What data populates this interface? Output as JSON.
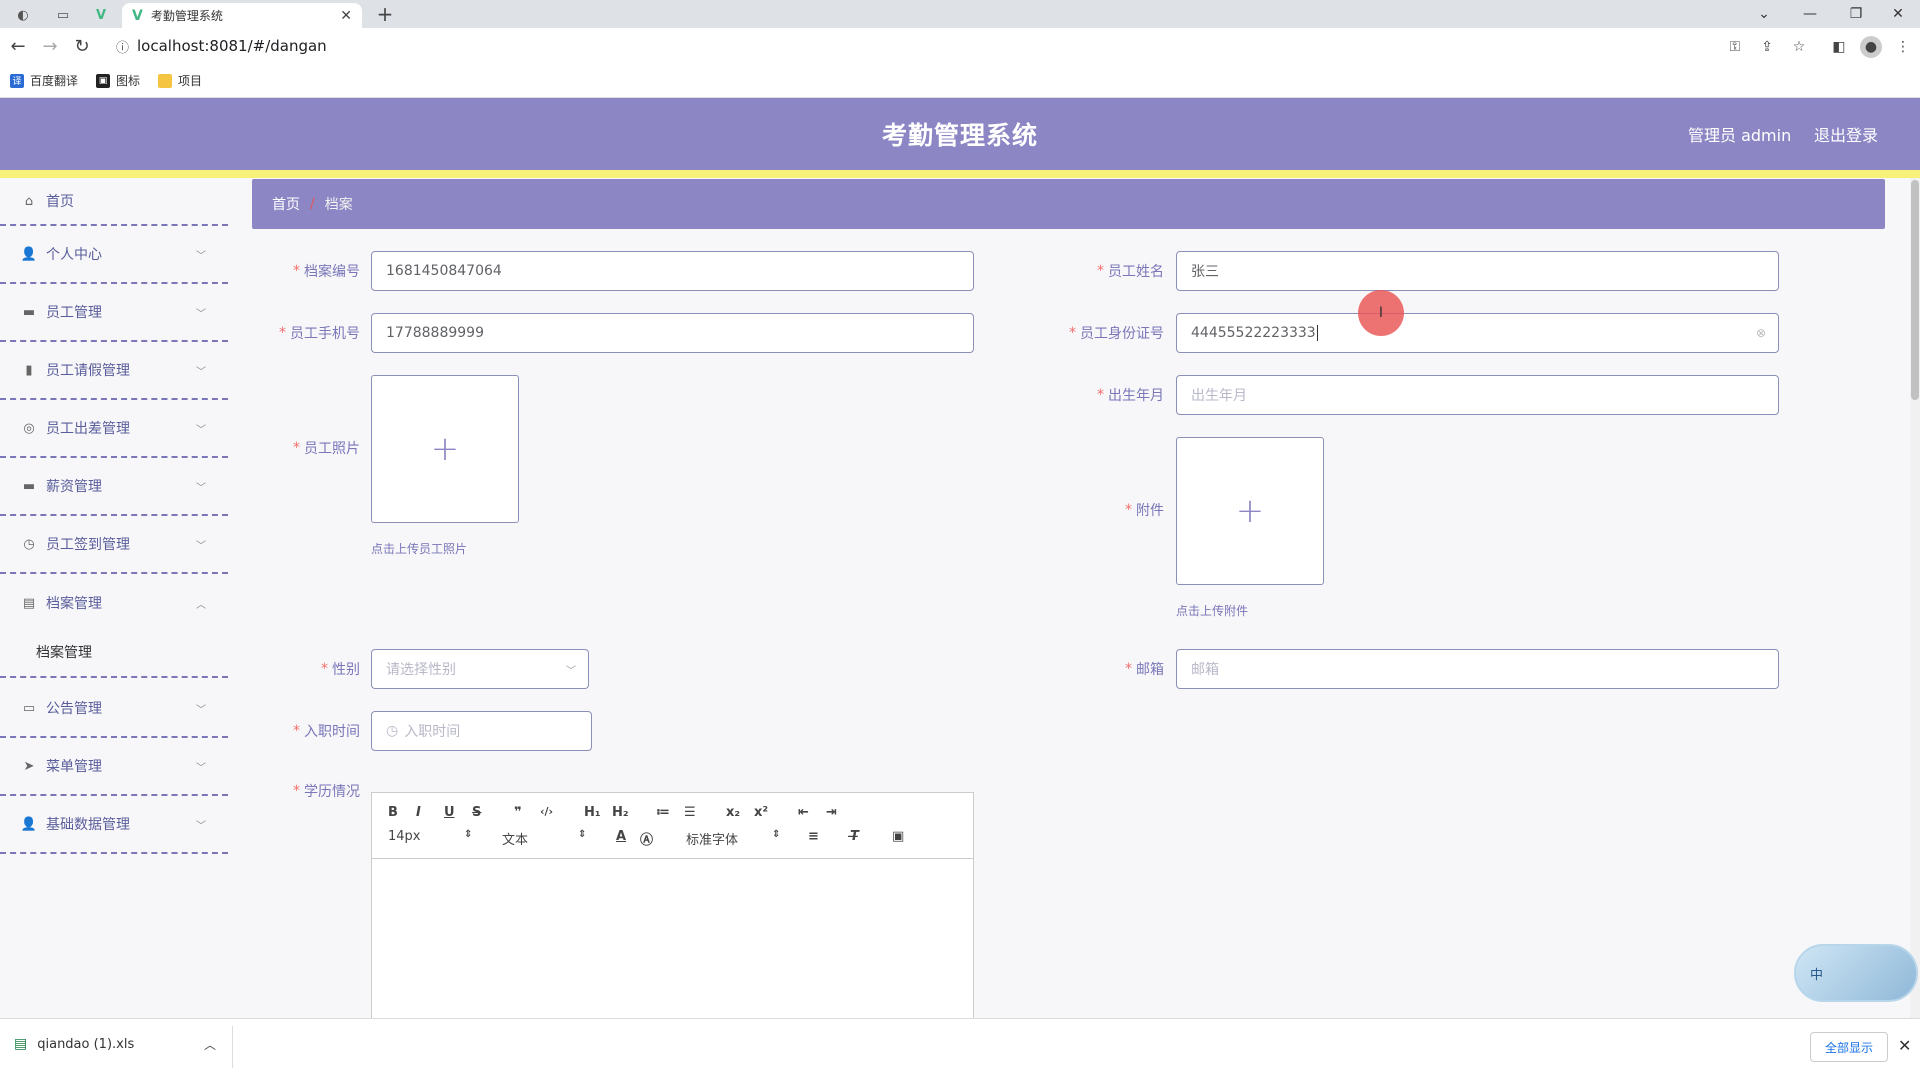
{
  "browser": {
    "tab_title": "考勤管理系统",
    "url": "localhost:8081/#/dangan",
    "bookmarks": [
      {
        "label": "百度翻译",
        "color": "#2b6cd4"
      },
      {
        "label": "图标",
        "color": "#222222"
      },
      {
        "label": "项目",
        "color": "#f5c542"
      }
    ]
  },
  "header": {
    "title": "考勤管理系统",
    "user": "管理员 admin",
    "logout": "退出登录",
    "bg_color": "#8c87c4",
    "accent_bar_color": "#f7f17a"
  },
  "sidebar": {
    "items": [
      {
        "label": "首页",
        "icon": "home-icon",
        "glyph": "⌂"
      },
      {
        "label": "个人中心",
        "icon": "user-icon",
        "glyph": "👤"
      },
      {
        "label": "员工管理",
        "icon": "briefcase-icon",
        "glyph": "▬"
      },
      {
        "label": "员工请假管理",
        "icon": "bar-chart-icon",
        "glyph": "▮"
      },
      {
        "label": "员工出差管理",
        "icon": "globe-icon",
        "glyph": "◎"
      },
      {
        "label": "薪资管理",
        "icon": "wallet-icon",
        "glyph": "▬"
      },
      {
        "label": "员工签到管理",
        "icon": "clock-icon",
        "glyph": "◷"
      },
      {
        "label": "档案管理",
        "icon": "document-icon",
        "glyph": "▤"
      },
      {
        "label": "公告管理",
        "icon": "monitor-icon",
        "glyph": "▭"
      },
      {
        "label": "菜单管理",
        "icon": "send-icon",
        "glyph": "➤"
      },
      {
        "label": "基础数据管理",
        "icon": "user-icon",
        "glyph": "👤"
      }
    ],
    "open_submenu_label": "档案管理"
  },
  "breadcrumb": {
    "home": "首页",
    "separator": "/",
    "current": "档案"
  },
  "form": {
    "archive_no": {
      "label": "档案编号",
      "value": "1681450847064"
    },
    "employee_name": {
      "label": "员工姓名",
      "value": "张三"
    },
    "employee_phone": {
      "label": "员工手机号",
      "value": "17788889999"
    },
    "employee_id_card": {
      "label": "员工身份证号",
      "value": "44455522223333"
    },
    "birth_month": {
      "label": "出生年月",
      "placeholder": "出生年月"
    },
    "employee_photo": {
      "label": "员工照片",
      "tip": "点击上传员工照片"
    },
    "attachment": {
      "label": "附件",
      "tip": "点击上传附件"
    },
    "gender": {
      "label": "性别",
      "placeholder": "请选择性别"
    },
    "email": {
      "label": "邮箱",
      "placeholder": "邮箱"
    },
    "hire_date": {
      "label": "入职时间",
      "placeholder": "入职时间"
    },
    "education": {
      "label": "学历情况"
    }
  },
  "editor": {
    "font_size": "14px",
    "heading_select": "文本",
    "font_family": "标准字体",
    "buttons": [
      "B",
      "I",
      "U",
      "S",
      "❞",
      "‹/›",
      "H₁",
      "H₂",
      "≔",
      "☰",
      "x₂",
      "x²",
      "⇤",
      "⇥"
    ]
  },
  "downloads": {
    "file": "qiandao (1).xls",
    "show_all": "全部显示"
  },
  "mascot_text": "中"
}
